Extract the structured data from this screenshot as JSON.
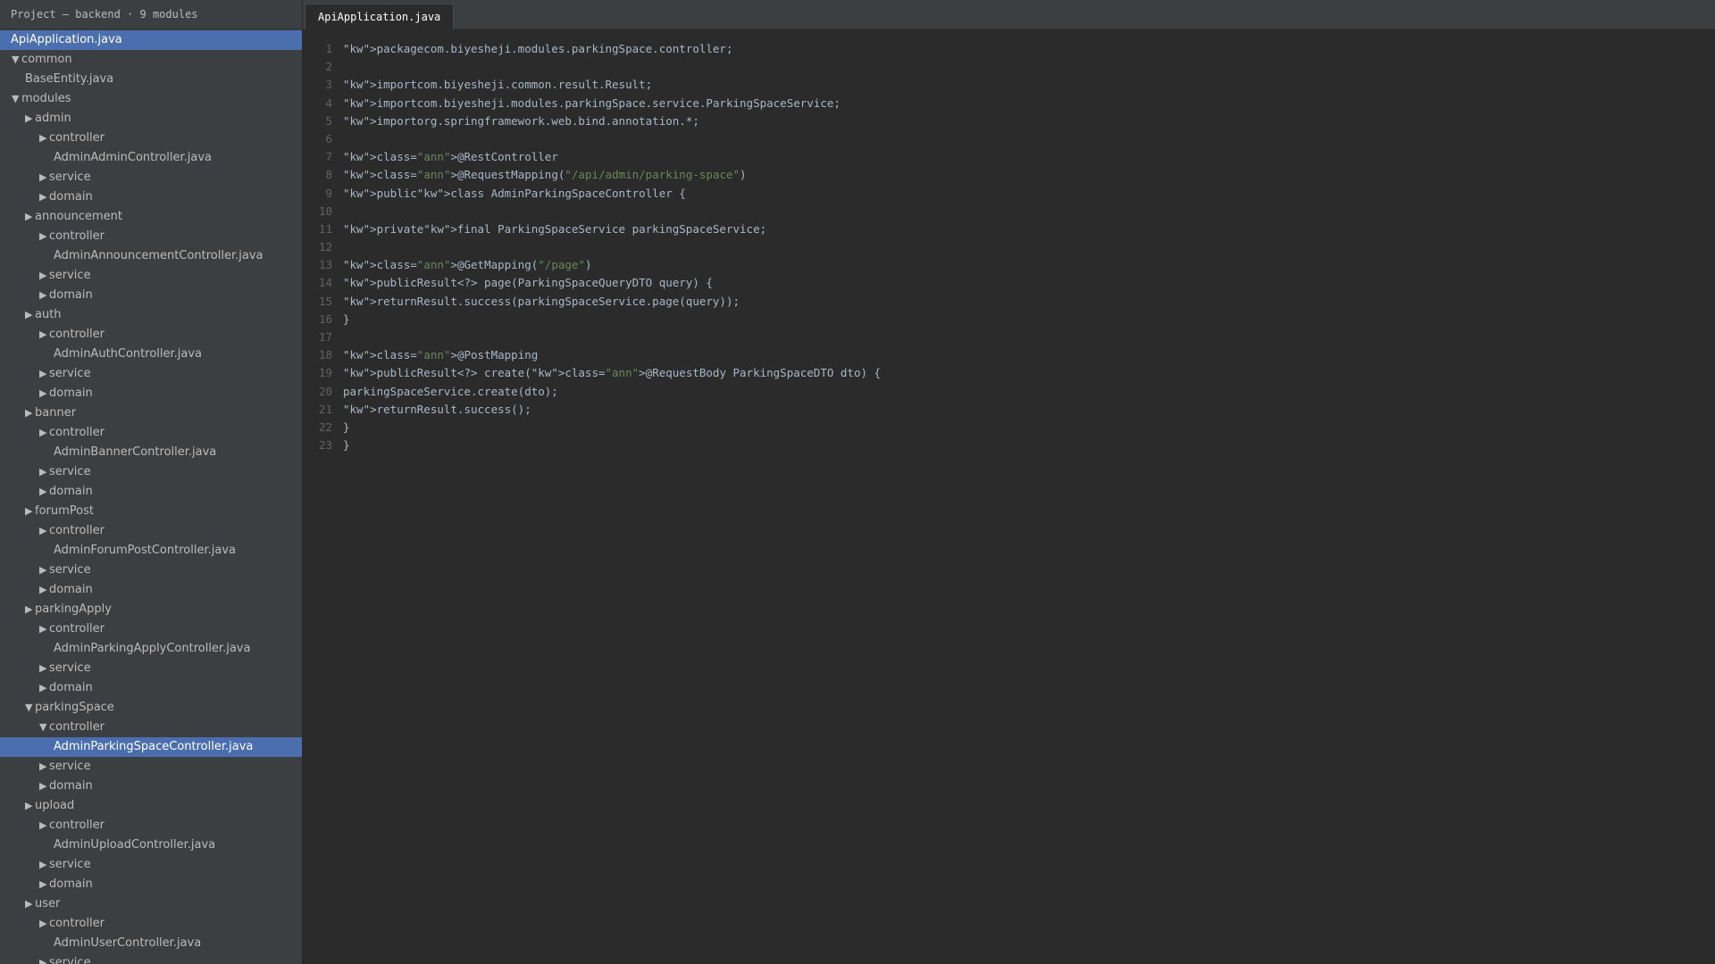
{
  "sidebar": {
    "header": "Project — backend · 9 modules",
    "items": [
      {
        "label": "ApiApplication.java",
        "arrow": "",
        "depth": "d0",
        "selected": true
      },
      {
        "label": "common",
        "arrow": "▼",
        "depth": "d1",
        "selected": false
      },
      {
        "label": "BaseEntity.java",
        "arrow": "",
        "depth": "d1f",
        "selected": false
      },
      {
        "label": "modules",
        "arrow": "▼",
        "depth": "d1",
        "selected": false
      },
      {
        "label": "admin",
        "arrow": "▶",
        "depth": "d2",
        "selected": false
      },
      {
        "label": "controller",
        "arrow": "▶",
        "depth": "d3",
        "selected": false
      },
      {
        "label": "AdminAdminController.java",
        "arrow": "",
        "depth": "d4",
        "selected": false
      },
      {
        "label": "service",
        "arrow": "▶",
        "depth": "d3",
        "selected": false
      },
      {
        "label": "domain",
        "arrow": "▶",
        "depth": "d3",
        "selected": false
      },
      {
        "label": "announcement",
        "arrow": "▶",
        "depth": "d2",
        "selected": false
      },
      {
        "label": "controller",
        "arrow": "▶",
        "depth": "d3",
        "selected": false
      },
      {
        "label": "AdminAnnouncementController.java",
        "arrow": "",
        "depth": "d4",
        "selected": false
      },
      {
        "label": "service",
        "arrow": "▶",
        "depth": "d3",
        "selected": false
      },
      {
        "label": "domain",
        "arrow": "▶",
        "depth": "d3",
        "selected": false
      },
      {
        "label": "auth",
        "arrow": "▶",
        "depth": "d2",
        "selected": false
      },
      {
        "label": "controller",
        "arrow": "▶",
        "depth": "d3",
        "selected": false
      },
      {
        "label": "AdminAuthController.java",
        "arrow": "",
        "depth": "d4",
        "selected": false
      },
      {
        "label": "service",
        "arrow": "▶",
        "depth": "d3",
        "selected": false
      },
      {
        "label": "domain",
        "arrow": "▶",
        "depth": "d3",
        "selected": false
      },
      {
        "label": "banner",
        "arrow": "▶",
        "depth": "d2",
        "selected": false
      },
      {
        "label": "controller",
        "arrow": "▶",
        "depth": "d3",
        "selected": false
      },
      {
        "label": "AdminBannerController.java",
        "arrow": "",
        "depth": "d4",
        "selected": false
      },
      {
        "label": "service",
        "arrow": "▶",
        "depth": "d3",
        "selected": false
      },
      {
        "label": "domain",
        "arrow": "▶",
        "depth": "d3",
        "selected": false
      },
      {
        "label": "forumPost",
        "arrow": "▶",
        "depth": "d2",
        "selected": false
      },
      {
        "label": "controller",
        "arrow": "▶",
        "depth": "d3",
        "selected": false
      },
      {
        "label": "AdminForumPostController.java",
        "arrow": "",
        "depth": "d4",
        "selected": false
      },
      {
        "label": "service",
        "arrow": "▶",
        "depth": "d3",
        "selected": false
      },
      {
        "label": "domain",
        "arrow": "▶",
        "depth": "d3",
        "selected": false
      },
      {
        "label": "parkingApply",
        "arrow": "▶",
        "depth": "d2",
        "selected": false
      },
      {
        "label": "controller",
        "arrow": "▶",
        "depth": "d3",
        "selected": false
      },
      {
        "label": "AdminParkingApplyController.java",
        "arrow": "",
        "depth": "d4",
        "selected": false
      },
      {
        "label": "service",
        "arrow": "▶",
        "depth": "d3",
        "selected": false
      },
      {
        "label": "domain",
        "arrow": "▶",
        "depth": "d3",
        "selected": false
      },
      {
        "label": "parkingSpace",
        "arrow": "▼",
        "depth": "d2",
        "selected": false
      },
      {
        "label": "controller",
        "arrow": "▼",
        "depth": "d3",
        "selected": false
      },
      {
        "label": "AdminParkingSpaceController.java",
        "arrow": "",
        "depth": "d4",
        "selected": true
      },
      {
        "label": "service",
        "arrow": "▶",
        "depth": "d3",
        "selected": false
      },
      {
        "label": "domain",
        "arrow": "▶",
        "depth": "d3",
        "selected": false
      },
      {
        "label": "upload",
        "arrow": "▶",
        "depth": "d2",
        "selected": false
      },
      {
        "label": "controller",
        "arrow": "▶",
        "depth": "d3",
        "selected": false
      },
      {
        "label": "AdminUploadController.java",
        "arrow": "",
        "depth": "d4",
        "selected": false
      },
      {
        "label": "service",
        "arrow": "▶",
        "depth": "d3",
        "selected": false
      },
      {
        "label": "domain",
        "arrow": "▶",
        "depth": "d3",
        "selected": false
      },
      {
        "label": "user",
        "arrow": "▶",
        "depth": "d2",
        "selected": false
      },
      {
        "label": "controller",
        "arrow": "▶",
        "depth": "d3",
        "selected": false
      },
      {
        "label": "AdminUserController.java",
        "arrow": "",
        "depth": "d4",
        "selected": false
      },
      {
        "label": "service",
        "arrow": "▶",
        "depth": "d3",
        "selected": false
      }
    ]
  },
  "editor": {
    "tab_label": "ApiApplication.java",
    "lines": [
      {
        "num": "1",
        "segments": [
          {
            "text": "\"kw\">packagecom.biyesheji.modules.parkingSpace.controller;",
            "cls": ""
          }
        ]
      },
      {
        "num": "2",
        "segments": []
      },
      {
        "num": "3",
        "segments": [
          {
            "text": "\"kw\">importcom.biyesheji.common.result.Result;",
            "cls": ""
          }
        ]
      },
      {
        "num": "4",
        "segments": [
          {
            "text": "\"kw\">importcom.biyesheji.modules.parkingSpace.service.ParkingSpaceService;",
            "cls": ""
          }
        ]
      },
      {
        "num": "5",
        "segments": [
          {
            "text": "\"kw\">importorg.springframework.web.bind.annotation.*;",
            "cls": ""
          }
        ]
      },
      {
        "num": "6",
        "segments": []
      },
      {
        "num": "7",
        "segments": [
          {
            "text": "\"kw\">class=",
            "cls": ""
          },
          {
            "text": "\"ann\"",
            "cls": "str"
          },
          {
            "text": ">@RestController",
            "cls": ""
          }
        ]
      },
      {
        "num": "8",
        "segments": [
          {
            "text": "\"kw\">class=",
            "cls": ""
          },
          {
            "text": "\"ann\"",
            "cls": "str"
          },
          {
            "text": ">@RequestMapping(",
            "cls": ""
          },
          {
            "text": "\"/api/admin/parking-space\"",
            "cls": "str"
          },
          {
            "text": ")",
            "cls": ""
          }
        ]
      },
      {
        "num": "9",
        "segments": [
          {
            "text": "\"kw\">public\"kw\">class AdminParkingSpaceController {",
            "cls": ""
          }
        ]
      },
      {
        "num": "10",
        "segments": []
      },
      {
        "num": "11",
        "segments": [
          {
            "text": "\"kw\">private\"kw\">final ParkingSpaceService parkingSpaceService;",
            "cls": ""
          }
        ]
      },
      {
        "num": "12",
        "segments": []
      },
      {
        "num": "13",
        "segments": [
          {
            "text": "\"kw\">class=",
            "cls": ""
          },
          {
            "text": "\"ann\"",
            "cls": "str"
          },
          {
            "text": ">@GetMapping(",
            "cls": ""
          },
          {
            "text": "\"/page\"",
            "cls": "str"
          },
          {
            "text": ")",
            "cls": ""
          }
        ]
      },
      {
        "num": "14",
        "segments": [
          {
            "text": "\"kw\">publicResult<?> page(ParkingSpaceQueryDTO query) {",
            "cls": ""
          }
        ]
      },
      {
        "num": "15",
        "segments": [
          {
            "text": "\"kw\">returnResult.success(parkingSpaceService.page(query));",
            "cls": ""
          }
        ]
      },
      {
        "num": "16",
        "segments": [
          {
            "text": "}",
            "cls": ""
          }
        ]
      },
      {
        "num": "17",
        "segments": []
      },
      {
        "num": "18",
        "segments": [
          {
            "text": "\"kw\">class=",
            "cls": ""
          },
          {
            "text": "\"ann\"",
            "cls": "str"
          },
          {
            "text": ">@PostMapping",
            "cls": ""
          }
        ]
      },
      {
        "num": "19",
        "segments": [
          {
            "text": "\"kw\">publicResult<?> create(\"kw\">class=",
            "cls": ""
          },
          {
            "text": "\"ann\"",
            "cls": "str"
          },
          {
            "text": ">@RequestBody ParkingSpaceDTO dto) {",
            "cls": ""
          }
        ]
      },
      {
        "num": "20",
        "segments": [
          {
            "text": "parkingSpaceService.create(dto);",
            "cls": ""
          }
        ]
      },
      {
        "num": "21",
        "segments": [
          {
            "text": "\"kw\">returnResult.success();",
            "cls": ""
          }
        ]
      },
      {
        "num": "22",
        "segments": [
          {
            "text": "}",
            "cls": ""
          }
        ]
      },
      {
        "num": "23",
        "segments": [
          {
            "text": "}",
            "cls": ""
          }
        ]
      }
    ]
  },
  "colors": {
    "sidebar_bg": "#3c3f41",
    "editor_bg": "#2b2b2b",
    "selection": "#4b6eaf",
    "code_text": "#a9b7c6",
    "string_text": "#6a8759",
    "line_number": "#606366"
  }
}
